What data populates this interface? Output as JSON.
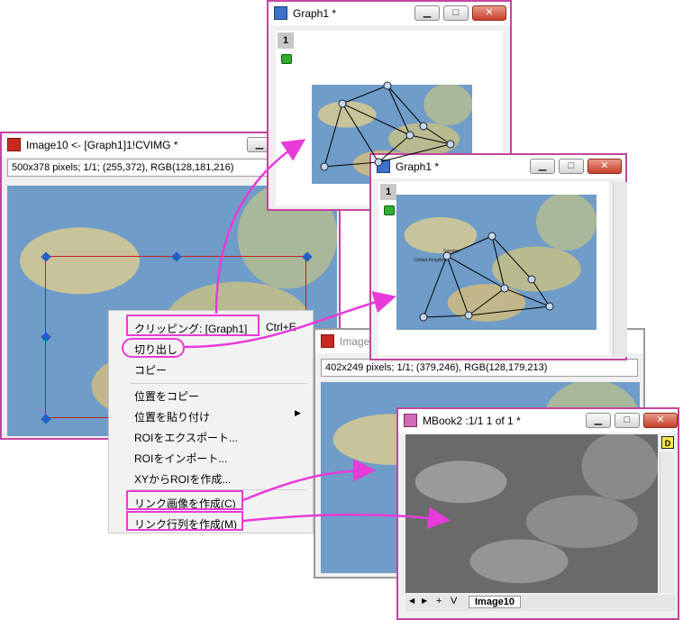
{
  "image_window": {
    "title": "Image10 <- [Graph1]1!CVIMG *",
    "info": "500x378 pixels; 1/1; (255,372), RGB(128,181,216)"
  },
  "graph1_top": {
    "title": "Graph1 *",
    "layer": "1"
  },
  "graph1_right": {
    "title": "Graph1 *",
    "layer": "1",
    "map_labels": [
      "Sweden",
      "United Kingdom"
    ]
  },
  "second_image_window": {
    "title": "Image",
    "info": "402x249 pixels; 1/1; (379,246), RGB(128,179,213)"
  },
  "mbook": {
    "title": "MBook2 :1/1 1 of 1 *",
    "d_badge": "D",
    "sheet_tab": "Image10",
    "nav_buttons": [
      "◀",
      "▶",
      "+",
      "V"
    ]
  },
  "context_menu": {
    "items": [
      {
        "label": "クリッピング: [Graph1]",
        "shortcut": "Ctrl+E"
      },
      {
        "label": "切り出し"
      },
      {
        "label": "コピー"
      },
      {
        "label": "位置をコピー"
      },
      {
        "label": "位置を貼り付け"
      },
      {
        "label": "ROIをエクスポート..."
      },
      {
        "label": "ROIをインポート..."
      },
      {
        "label": "XYからROIを作成..."
      },
      {
        "label": "リンク画像を作成(C)"
      },
      {
        "label": "リンク行列を作成(M)"
      }
    ]
  },
  "colors": {
    "accent": "#c4459e",
    "arrow": "#e83bd9"
  }
}
